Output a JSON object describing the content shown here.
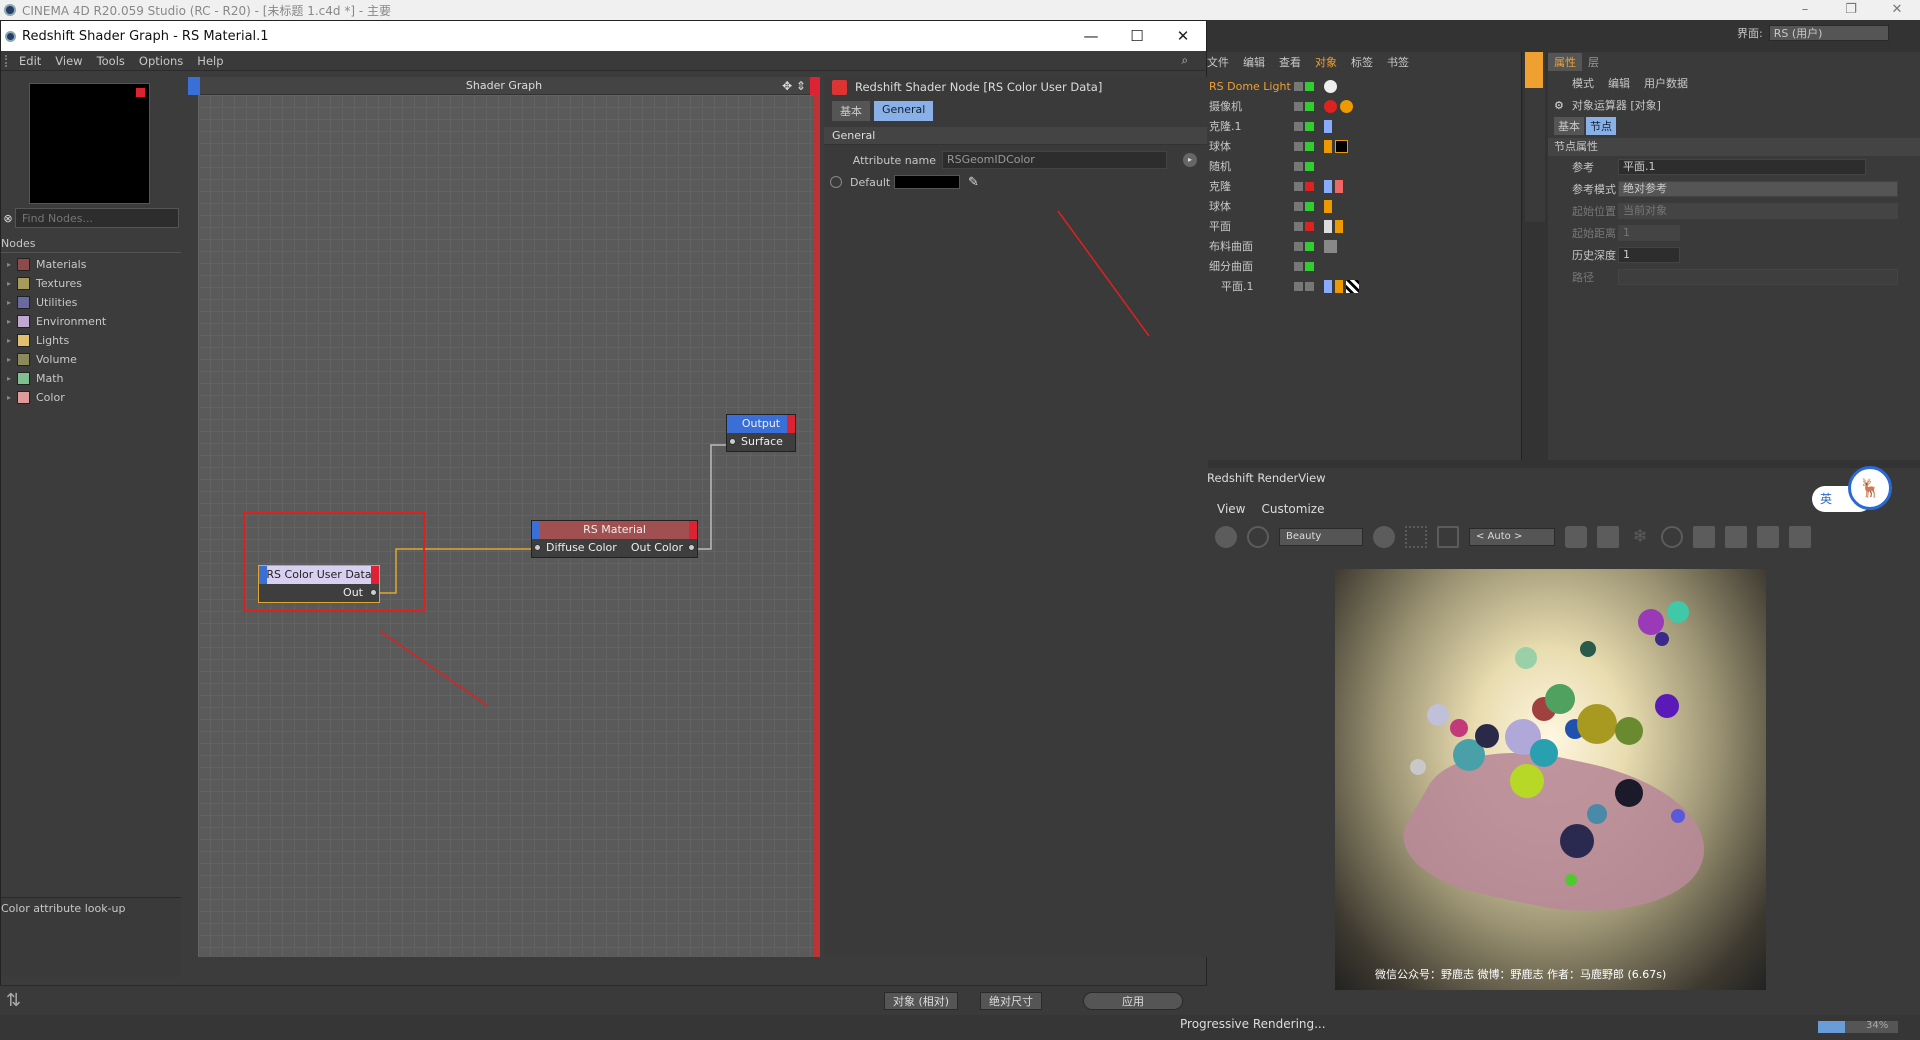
{
  "c4d": {
    "title": "CINEMA 4D R20.059 Studio (RC - R20) - [未标题 1.c4d *] - 主要",
    "layout_label": "界面:",
    "layout_value": "RS (用户)"
  },
  "shader_graph": {
    "window_title": "Redshift Shader Graph - RS Material.1",
    "menu": [
      "Edit",
      "View",
      "Tools",
      "Options",
      "Help"
    ],
    "find_placeholder": "Find Nodes...",
    "nodes_header": "Nodes",
    "categories": [
      {
        "label": "Materials",
        "color": "#8c4a4a"
      },
      {
        "label": "Textures",
        "color": "#a89a5a"
      },
      {
        "label": "Utilities",
        "color": "#6a6aa0"
      },
      {
        "label": "Environment",
        "color": "#c0a8d0"
      },
      {
        "label": "Lights",
        "color": "#e0c070"
      },
      {
        "label": "Volume",
        "color": "#8a8a5a"
      },
      {
        "label": "Math",
        "color": "#80c090"
      },
      {
        "label": "Color",
        "color": "#e09a9a"
      }
    ],
    "description": "Color attribute look-up",
    "graph_title": "Shader Graph",
    "nodes": {
      "output": {
        "title": "Output",
        "port": "Surface"
      },
      "rs_material": {
        "title": "RS Material",
        "in_port": "Diffuse Color",
        "out_port": "Out Color"
      },
      "color_user_data": {
        "title": "RS Color User Data",
        "out_port": "Out"
      }
    }
  },
  "attributes": {
    "title": "Redshift Shader Node [RS Color User Data]",
    "tabs": [
      "基本",
      "General"
    ],
    "section": "General",
    "attribute_name_label": "Attribute name",
    "attribute_name_value": "RSGeomIDColor",
    "default_label": "Default"
  },
  "bottom_bar": {
    "coord_mode": "对象 (相对)",
    "size_mode": "绝对尺寸",
    "apply": "应用"
  },
  "object_manager": {
    "menu": [
      "文件",
      "编辑",
      "查看",
      "对象",
      "标签",
      "书签"
    ],
    "objects": [
      "RS Dome Light",
      "摄像机",
      "克隆.1",
      "球体",
      "随机",
      "克隆",
      "球体",
      "平面",
      "布料曲面",
      "细分曲面",
      "平面.1"
    ]
  },
  "attribute_manager": {
    "tabs": [
      "属性",
      "层"
    ],
    "menu": [
      "模式",
      "编辑",
      "用户数据"
    ],
    "heading": "对象运算器 [对象]",
    "subtabs": [
      "基本",
      "节点"
    ],
    "section": "节点属性",
    "rows": [
      {
        "label": "参考",
        "value": "平面.1"
      },
      {
        "label": "参考模式",
        "value": "绝对参考"
      },
      {
        "label": "起始位置",
        "value": "当前对象"
      },
      {
        "label": "起始距离",
        "value": "1"
      },
      {
        "label": "历史深度",
        "value": "1"
      },
      {
        "label": "路径",
        "value": ""
      }
    ]
  },
  "render_view": {
    "title": "Redshift RenderView",
    "menu": [
      "View",
      "Customize"
    ],
    "aov": "Beauty",
    "zoom": "< Auto >",
    "caption": "微信公众号：野鹿志  微博：野鹿志  作者：马鹿野郎  (6.67s)",
    "status": "Progressive Rendering...",
    "progress_percent": 34,
    "progress_text": "34%"
  },
  "ime": {
    "label": "英"
  }
}
